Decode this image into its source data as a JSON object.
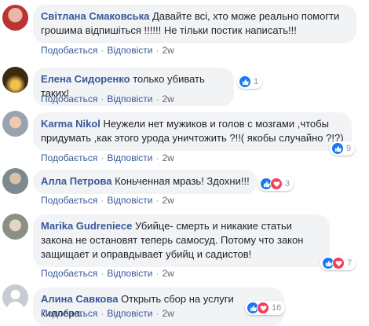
{
  "actions": {
    "like": "Подобається",
    "reply": "Відповісти",
    "time": "2w"
  },
  "colors": {
    "author": "#385898",
    "bubble": "#f2f3f5",
    "like": "#1877f2",
    "love": "#f33e58"
  },
  "comments": [
    {
      "author": "Світлана Смаковська",
      "text": "Давайте всі, хто може реально помогти грошима відпишіться !!!!!! Не тільки постик написать!!!",
      "reactions": null
    },
    {
      "author": "Елена Сидоренко",
      "text": "только убивать таких!",
      "reactions": {
        "types": [
          "like"
        ],
        "count": "1"
      }
    },
    {
      "author": "Karma Nikol",
      "text": "Неужели нет мужиков и голов с мозгами ,чтобы придумать ,как этого урода уничтожить ?!!( якобы случайно ?!?)",
      "reactions": {
        "types": [
          "like"
        ],
        "count": "9"
      }
    },
    {
      "author": "Алла Петрова",
      "text": "Коньченная мразь! Здохни!!!",
      "reactions": {
        "types": [
          "like",
          "love"
        ],
        "count": "3"
      }
    },
    {
      "author": "Marika Gudreniece",
      "text": "Убийце- смерть и никакие статьи закона не остановят теперь самосуд. Потому что закон защищает и оправдывает убийц и садистов!",
      "reactions": {
        "types": [
          "like",
          "love"
        ],
        "count": "7"
      }
    },
    {
      "author": "Алина Савкова",
      "text": "Открыть сбор на услуги киллера.",
      "reactions": {
        "types": [
          "like",
          "love"
        ],
        "count": "16"
      }
    }
  ]
}
